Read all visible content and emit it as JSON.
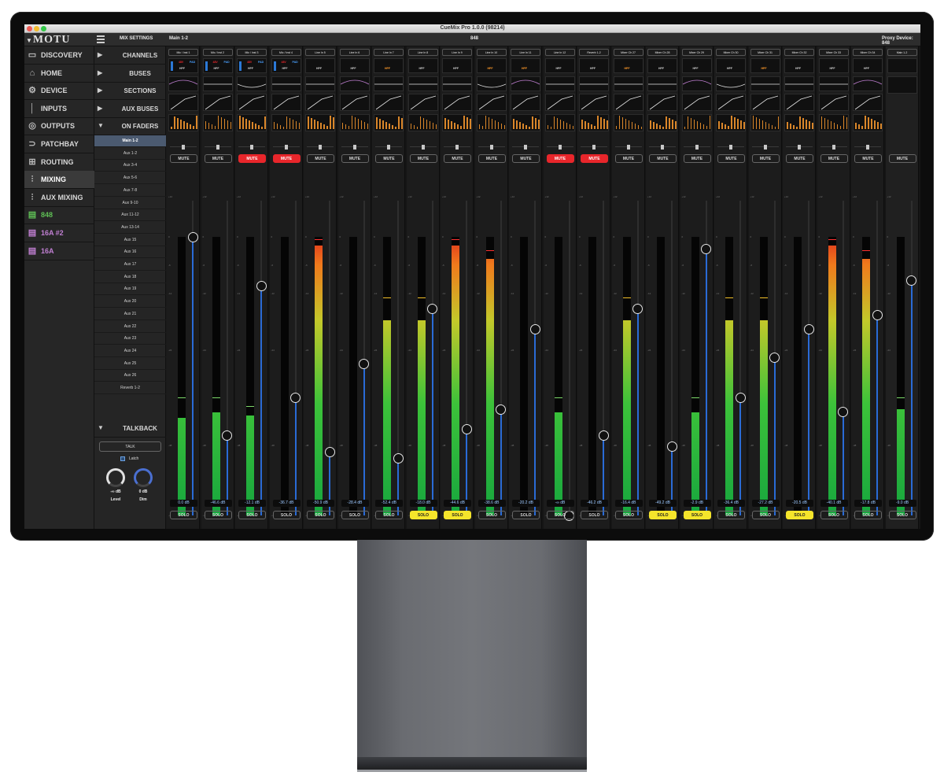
{
  "window": {
    "title": "CueMix Pro 1.0.0 (98214)"
  },
  "topbar": {
    "logo": "MOTU",
    "section": "MIX SETTINGS",
    "mix": "Main 1-2",
    "device": "848",
    "proxy": "Proxy Device: 848"
  },
  "nav": {
    "items": [
      {
        "label": "DISCOVERY",
        "icon": "discovery-icon",
        "glyph": "▭"
      },
      {
        "label": "HOME",
        "icon": "home-icon",
        "glyph": "⌂"
      },
      {
        "label": "DEVICE",
        "icon": "gear-icon",
        "glyph": "⚙"
      },
      {
        "label": "INPUTS",
        "icon": "input-icon",
        "glyph": "│"
      },
      {
        "label": "OUTPUTS",
        "icon": "output-icon",
        "glyph": "◎"
      },
      {
        "label": "PATCHBAY",
        "icon": "patchbay-icon",
        "glyph": "⊃"
      },
      {
        "label": "ROUTING",
        "icon": "routing-icon",
        "glyph": "⊞"
      },
      {
        "label": "MIXING",
        "icon": "mixing-icon",
        "glyph": "⫶"
      },
      {
        "label": "AUX MIXING",
        "icon": "aux-mixing-icon",
        "glyph": "⫶"
      },
      {
        "label": "848",
        "icon": "device-848-icon",
        "glyph": "▤"
      },
      {
        "label": "16A #2",
        "icon": "device-16a2-icon",
        "glyph": "▤"
      },
      {
        "label": "16A",
        "icon": "device-16a-icon",
        "glyph": "▤"
      }
    ],
    "selected": "MIXING"
  },
  "tree": {
    "sections": [
      "CHANNELS",
      "BUSES",
      "SECTIONS",
      "AUX BUSES",
      "ON FADERS"
    ],
    "faders": [
      "Main 1-2",
      "Aux 1-2",
      "Aux 3-4",
      "Aux 5-6",
      "Aux 7-8",
      "Aux 9-10",
      "Aux 11-12",
      "Aux 13-14",
      "Aux 15",
      "Aux 16",
      "Aux 17",
      "Aux 18",
      "Aux 19",
      "Aux 20",
      "Aux 21",
      "Aux 22",
      "Aux 23",
      "Aux 24",
      "Aux 25",
      "Aux 26",
      "Reverb 1-2"
    ],
    "selected_fader": "Main 1-2",
    "talkback": {
      "title": "TALKBACK",
      "talk": "TALK",
      "latch": "Latch",
      "level_value": "-∞ dB",
      "level_label": "Level",
      "dim_value": "0 dB",
      "dim_label": "Dim"
    }
  },
  "labels": {
    "mute": "MUTE",
    "solo": "SOLO",
    "hpf": "HPF",
    "pad": "PAD",
    "hiz": "48V",
    "gain": "GAIN"
  },
  "ticks": [
    "+12",
    "0",
    "-6",
    "-12",
    "-24",
    "-48",
    "-∞"
  ],
  "strips": [
    {
      "name": "Mic / Inst 1",
      "db": "0.0 dB",
      "mute": false,
      "solo": false,
      "level": 0.35,
      "fader": 0.97,
      "peak": 0.42,
      "pre": true
    },
    {
      "name": "Mic / Inst 2",
      "db": "-46.6 dB",
      "mute": false,
      "solo": false,
      "level": 0.37,
      "fader": 0.28,
      "peak": 0.42,
      "pre": true
    },
    {
      "name": "Mic / Inst 3",
      "db": "-12.1 dB",
      "mute": true,
      "solo": false,
      "level": 0.36,
      "fader": 0.8,
      "peak": 0.39,
      "pre": true
    },
    {
      "name": "Mic / Inst 4",
      "db": "-36.7 dB",
      "mute": true,
      "solo": false,
      "level": 0,
      "fader": 0.41,
      "peak": 0,
      "pre": true
    },
    {
      "name": "Line In 5",
      "db": "-50.9 dB",
      "mute": false,
      "solo": false,
      "level": 0.97,
      "fader": 0.22,
      "peak": 0.99,
      "pre": false
    },
    {
      "name": "Line In 6",
      "db": "-28.4 dB",
      "mute": false,
      "solo": false,
      "level": 0,
      "fader": 0.53,
      "peak": 0,
      "pre": false
    },
    {
      "name": "Line In 7",
      "db": "-52.4 dB",
      "mute": false,
      "solo": false,
      "level": 0.7,
      "fader": 0.2,
      "peak": 0.78,
      "pre": false
    },
    {
      "name": "Line In 8",
      "db": "-18.0 dB",
      "mute": false,
      "solo": true,
      "level": 0.7,
      "fader": 0.72,
      "peak": 0.78,
      "pre": false
    },
    {
      "name": "Line In 9",
      "db": "-44.6 dB",
      "mute": false,
      "solo": true,
      "level": 0.97,
      "fader": 0.3,
      "peak": 0.99,
      "pre": false
    },
    {
      "name": "Line In 10",
      "db": "-38.6 dB",
      "mute": false,
      "solo": false,
      "level": 0.92,
      "fader": 0.37,
      "peak": 0.95,
      "pre": false
    },
    {
      "name": "Line In 11",
      "db": "-20.2 dB",
      "mute": false,
      "solo": false,
      "level": 0,
      "fader": 0.65,
      "peak": 0,
      "pre": false
    },
    {
      "name": "Line In 12",
      "db": "-∞ dB",
      "mute": true,
      "solo": false,
      "level": 0.37,
      "fader": 0,
      "peak": 0.42,
      "pre": false
    },
    {
      "name": "Reverb 1-2",
      "db": "-46.2 dB",
      "mute": true,
      "solo": false,
      "level": 0,
      "fader": 0.28,
      "peak": 0,
      "pre": false
    },
    {
      "name": "Mixer Ch 27",
      "db": "-16.4 dB",
      "mute": false,
      "solo": false,
      "level": 0.7,
      "fader": 0.72,
      "peak": 0.78,
      "pre": false
    },
    {
      "name": "Mixer Ch 28",
      "db": "-49.2 dB",
      "mute": false,
      "solo": true,
      "level": 0,
      "fader": 0.24,
      "peak": 0,
      "pre": false
    },
    {
      "name": "Mixer Ch 29",
      "db": "-2.9 dB",
      "mute": false,
      "solo": true,
      "level": 0.37,
      "fader": 0.93,
      "peak": 0.42,
      "pre": false
    },
    {
      "name": "Mixer Ch 30",
      "db": "-36.4 dB",
      "mute": false,
      "solo": false,
      "level": 0.7,
      "fader": 0.41,
      "peak": 0.78,
      "pre": false
    },
    {
      "name": "Mixer Ch 31",
      "db": "-27.2 dB",
      "mute": false,
      "solo": false,
      "level": 0.7,
      "fader": 0.55,
      "peak": 0.78,
      "pre": false
    },
    {
      "name": "Mixer Ch 32",
      "db": "-20.5 dB",
      "mute": false,
      "solo": true,
      "level": 0,
      "fader": 0.65,
      "peak": 0,
      "pre": false
    },
    {
      "name": "Mixer Ch 33",
      "db": "-40.1 dB",
      "mute": false,
      "solo": false,
      "level": 0.97,
      "fader": 0.36,
      "peak": 0.99,
      "pre": false
    },
    {
      "name": "Mixer Ch 34",
      "db": "-17.8 dB",
      "mute": false,
      "solo": false,
      "level": 0.92,
      "fader": 0.7,
      "peak": 0.95,
      "pre": false
    },
    {
      "name": "Main 1-2",
      "db": "-9.0 dB",
      "mute": false,
      "solo": false,
      "level": 0.38,
      "fader": 0.82,
      "peak": 0.42,
      "pre": false,
      "main": true
    }
  ],
  "colors": {
    "mute_on": "#e8262b",
    "solo_on": "#f5e52b",
    "fader_blue": "#2a6bd6",
    "green_device": "#5fbf55",
    "purple_device": "#c07fd2"
  }
}
